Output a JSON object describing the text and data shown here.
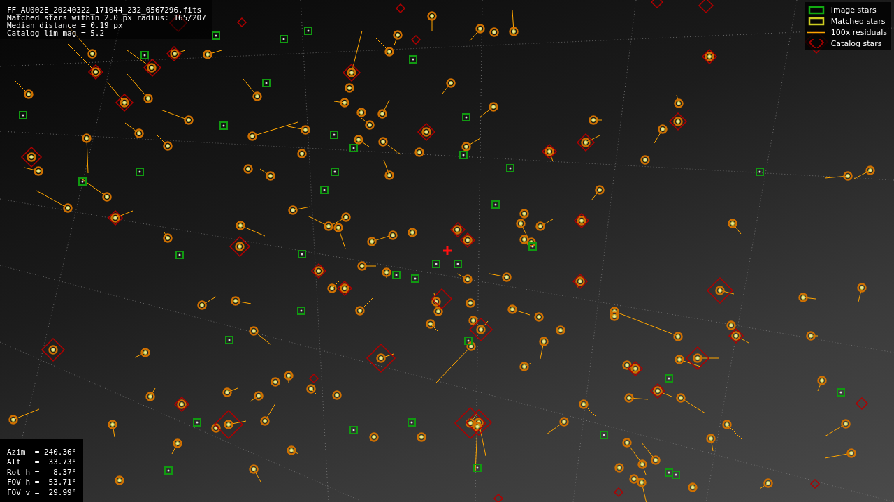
{
  "info_lines": [
    "FF_AU002E_20240322_171044_232_0567296.fits",
    "Matched stars within 2.0 px radius: 165/207",
    "Median distance = 0.19 px",
    "Catalog lim mag = 5.2"
  ],
  "legend": [
    {
      "label": "Image stars",
      "kind": "image"
    },
    {
      "label": "Matched stars",
      "kind": "matched"
    },
    {
      "label": "100x residuals",
      "kind": "residual"
    },
    {
      "label": "Catalog stars",
      "kind": "catalog"
    }
  ],
  "pointing_lines": [
    "Azim  = 240.36°",
    "Alt   =  33.73°",
    "Rot h =  -8.37°",
    "FOV h =  53.71°",
    "FOV v =  29.99°"
  ]
}
